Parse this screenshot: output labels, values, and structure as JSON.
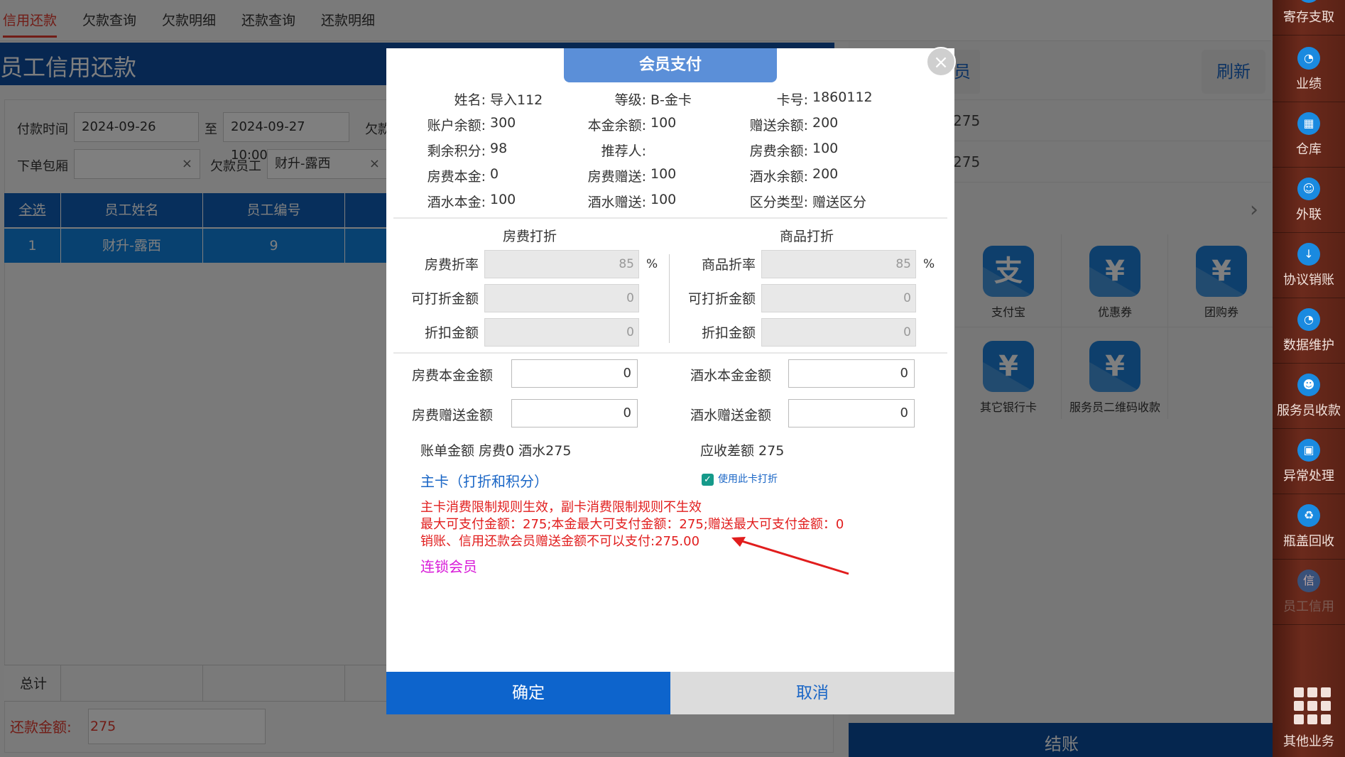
{
  "top_tabs": [
    "信用还款",
    "欠款查询",
    "欠款明细",
    "还款查询",
    "还款明细"
  ],
  "page": {
    "title": "员工信用还款",
    "filters": {
      "pay_time_label": "付款时间",
      "date_from": "2024-09-26 10:00 ▼",
      "to_label": "至",
      "date_to": "2024-09-27 10:00 ▼",
      "debt_label_cut": "欠款",
      "room_label": "下单包厢",
      "room_value": "",
      "employee_label": "欠款员工",
      "employee_value": "财升-露西",
      "clear": "×"
    },
    "grid": {
      "headers": [
        "全选",
        "员工姓名",
        "员工编号"
      ],
      "rows": [
        [
          "1",
          "财升-露西",
          "9"
        ]
      ],
      "total_label": "总计"
    },
    "pay_amount_label": "还款金额:",
    "pay_amount_value": "275"
  },
  "right": {
    "tab_label": "员",
    "refresh": "刷新",
    "lines": [
      "275",
      "275"
    ],
    "chevron": "›",
    "payment_methods": [
      {
        "label": "支付宝",
        "icon": "alipay-icon",
        "glyph": "支"
      },
      {
        "label": "优惠券",
        "icon": "coupon-icon",
        "glyph": "¥"
      },
      {
        "label": "团购券",
        "icon": "group-coupon-icon",
        "glyph": "¥"
      },
      {
        "label": "其它银行卡",
        "icon": "bank-card-icon",
        "glyph": "¥"
      },
      {
        "label": "服务员二维码收款",
        "icon": "qrcode-pay-icon",
        "glyph": "¥"
      }
    ],
    "checkout": "结账"
  },
  "sidebar": {
    "items": [
      "寄存支取",
      "业绩",
      "仓库",
      "外联",
      "协议销账",
      "数据维护",
      "服务员收款",
      "异常处理",
      "瓶盖回收",
      "员工信用"
    ],
    "more": "其他业务"
  },
  "modal": {
    "title": "会员支付",
    "close": "×",
    "info": [
      {
        "k": "姓名:",
        "v": "导入112"
      },
      {
        "k": "等级:",
        "v": "B-金卡"
      },
      {
        "k": "卡号:",
        "v": "1860112"
      },
      {
        "k": "账户余额:",
        "v": "300"
      },
      {
        "k": "本金余额:",
        "v": "100"
      },
      {
        "k": "赠送余额:",
        "v": "200"
      },
      {
        "k": "剩余积分:",
        "v": "98"
      },
      {
        "k": "推荐人:",
        "v": ""
      },
      {
        "k": "房费余额:",
        "v": "100"
      },
      {
        "k": "房费本金:",
        "v": "0"
      },
      {
        "k": "房费赠送:",
        "v": "100"
      },
      {
        "k": "酒水余额:",
        "v": "200"
      },
      {
        "k": "酒水本金:",
        "v": "100"
      },
      {
        "k": "酒水赠送:",
        "v": "100"
      },
      {
        "k": "区分类型:",
        "v": "赠送区分"
      }
    ],
    "room_discount": {
      "heading": "房费打折",
      "rate_label": "房费折率",
      "rate": "85",
      "pct": "%",
      "discountable_label": "可打折金额",
      "discountable": "0",
      "discount_label": "折扣金额",
      "discount": "0"
    },
    "goods_discount": {
      "heading": "商品打折",
      "rate_label": "商品折率",
      "rate": "85",
      "pct": "%",
      "discountable_label": "可打折金额",
      "discountable": "0",
      "discount_label": "折扣金额",
      "discount": "0"
    },
    "amounts": {
      "room_principal_label": "房费本金金额",
      "room_principal": "0",
      "room_gift_label": "房费赠送金额",
      "room_gift": "0",
      "drink_principal_label": "酒水本金金额",
      "drink_principal": "0",
      "drink_gift_label": "酒水赠送金额",
      "drink_gift": "0"
    },
    "bill_amount": "账单金额 房费0 酒水275",
    "receivable_diff": "应收差额 275",
    "main_card_link": "主卡（打折和积分）",
    "use_card_discount": "使用此卡打折",
    "check_mark": "✓",
    "notices": [
      "主卡消费限制规则生效，副卡消费限制规则不生效",
      "最大可支付金额：275;本金最大可支付金额：275;赠送最大可支付金额：0",
      "销账、信用还款会员赠送金额不可以支付:275.00"
    ],
    "chain_member": "连锁会员",
    "ok": "确定",
    "cancel": "取消"
  },
  "colors": {
    "primary_blue": "#0d64cc",
    "header_blue": "#0e4fa3",
    "notice_red": "#e11d1d",
    "chain_magenta": "#d81ad8",
    "sidebar_brown": "#5a2216"
  }
}
